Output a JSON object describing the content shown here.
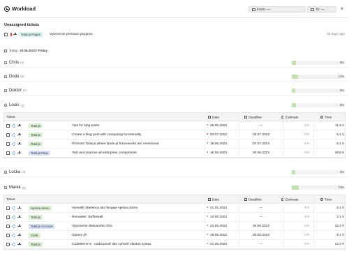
{
  "header": {
    "title": "Workload",
    "from_label": "From: —",
    "to_label": "To: —",
    "close": "×"
  },
  "unassigned": {
    "title": "Unassigned tickets",
    "row": {
      "tag": "Total.js Pages",
      "text": "Vytvorenie prémium pluginov",
      "ago": "16 days ago"
    }
  },
  "today": {
    "label": "Today:",
    "date": "20.06.2023 / Friday"
  },
  "people": {
    "chris": {
      "name": "Chris",
      "count": "(4)",
      "percent": "8%",
      "fill": 0.08
    },
    "dodo": {
      "name": "Dodo",
      "count": "(6)",
      "percent": "12%",
      "fill": 0.12
    },
    "doktor": {
      "name": "Doktor",
      "count": "(3)",
      "percent": "6%",
      "fill": 0.06
    },
    "louis": {
      "name": "Louis",
      "count": "(4)",
      "percent": "8%",
      "fill": 0.08
    },
    "lucka": {
      "name": "Lucka",
      "count": "(3)",
      "percent": "6%",
      "fill": 0.06
    },
    "marek": {
      "name": "Marek",
      "count": "(6)",
      "percent": "13%",
      "fill": 0.13
    }
  },
  "columns": {
    "ticket": "Ticket",
    "date": "Date",
    "deadline": "Deadline",
    "estimate": "Estimate",
    "time": "Time"
  },
  "louis_rows": [
    {
      "tag": "Total.js",
      "desc": "Tips for blog posts",
      "date": "26.05.2023",
      "deadline": "—",
      "estimate": "0 h",
      "time": "11.6 h"
    },
    {
      "tag": "Total.js",
      "desc": "Create a blog post with comparing functionality",
      "date": "03.07.2023",
      "deadline": "03.07.2023",
      "estimate": "0 h",
      "time": "5.1 h"
    },
    {
      "tag": "Total.js",
      "desc": "Promote Total.js where Node.js frameworks are mentioned",
      "date": "19.06.2023",
      "deadline": "07.07.2023",
      "estimate": "0 h",
      "time": "5.1 h"
    },
    {
      "tag": "Total.js Flow",
      "desc": "Test and improve all enterprise components",
      "date": "16.06.2023",
      "deadline": "30.06.2023",
      "estimate": "0 h",
      "time": "38.6 h"
    }
  ],
  "marek_rows": [
    {
      "tag": "Správa domu",
      "desc": "Vysvetliť Marekovi ako funguje správa domu",
      "date": "21.06.2023",
      "deadline": "—",
      "estimate": "0 h",
      "time": "5.1 h"
    },
    {
      "tag": "Total.js",
      "desc": "Remaster: Bufferwall",
      "date": "14.06.2023",
      "deadline": "—",
      "estimate": "0 h",
      "time": "2.1 h"
    },
    {
      "tag": "Total.js Account",
      "desc": "Vytvorenie diskusného fóra",
      "date": "23.06.2023",
      "deadline": "30.06.2023",
      "estimate": "0 h",
      "time": "32.2 h"
    },
    {
      "tag": "Clerk",
      "desc": "Úpravy jží",
      "date": "28.06.2023",
      "deadline": "30.06.2023",
      "estimate": "0 h",
      "time": "6.1 h"
    },
    {
      "tag": "Total.js",
      "desc": "CodeMirror 6 - nadizuovať ako vytvoriť vlastnú syntax",
      "date": "21.06.2023",
      "deadline": "—",
      "estimate": "0 h",
      "time": "12.3 h"
    }
  ],
  "colors": {
    "bar_fill": "#c4e0b6",
    "tag_green": "#dcefd6",
    "tag_blue": "#d6dff3",
    "overdue": "#e04343"
  },
  "icons": [
    "clock-icon",
    "calendar-icon",
    "calculator-icon",
    "priority-icon",
    "tree-icon",
    "assign-user-icon",
    "stopwatch-icon",
    "expand-icon"
  ]
}
